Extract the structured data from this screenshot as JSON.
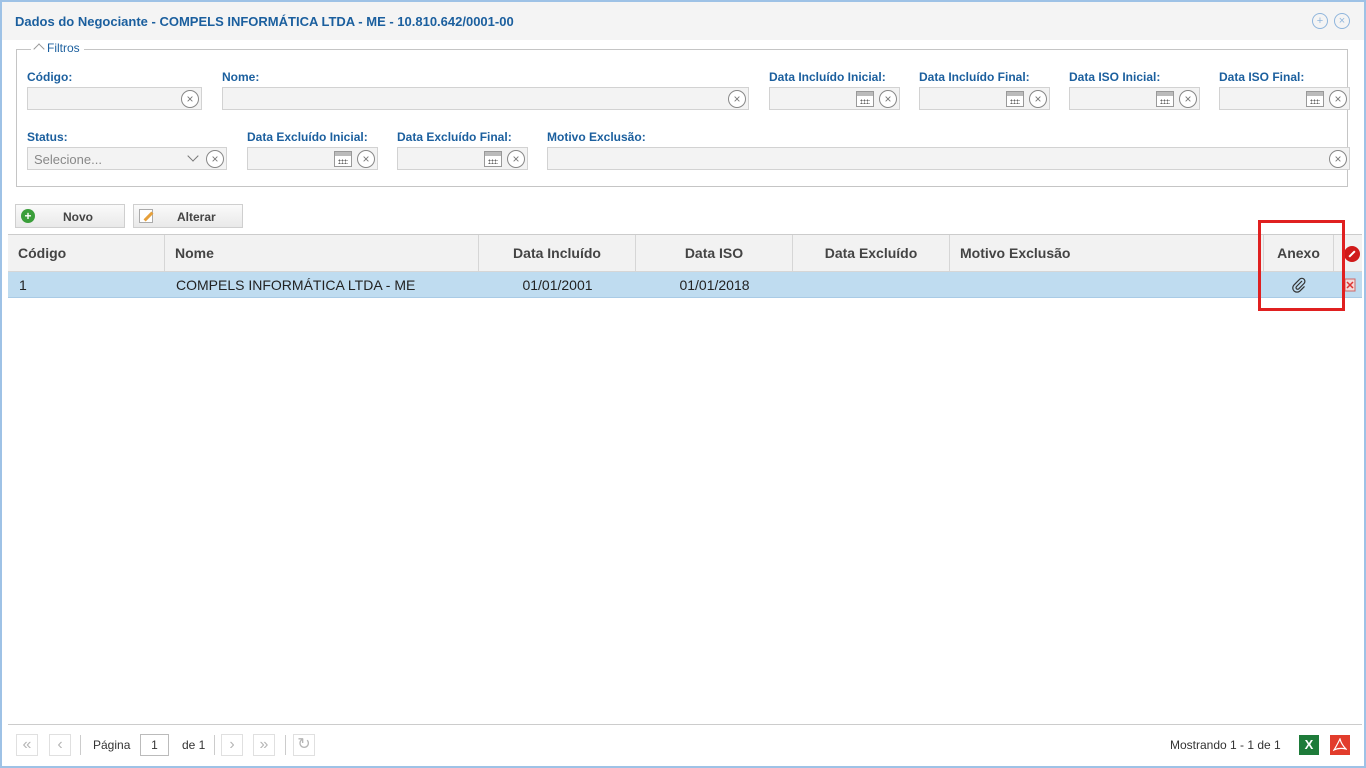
{
  "window": {
    "title": "Dados do Negociante - COMPELS INFORMÁTICA LTDA - ME - 10.810.642/0001-00"
  },
  "filters": {
    "legend": "Filtros",
    "codigo_label": "Código:",
    "nome_label": "Nome:",
    "data_incluido_inicial_label": "Data Incluído Inicial:",
    "data_incluido_final_label": "Data Incluído Final:",
    "data_iso_inicial_label": "Data ISO Inicial:",
    "data_iso_final_label": "Data ISO Final:",
    "status_label": "Status:",
    "status_placeholder": "Selecione...",
    "data_excluido_inicial_label": "Data Excluído Inicial:",
    "data_excluido_final_label": "Data Excluído Final:",
    "motivo_exclusao_label": "Motivo Exclusão:"
  },
  "toolbar": {
    "novo_label": "Novo",
    "alterar_label": "Alterar"
  },
  "grid": {
    "columns": [
      "Código",
      "Nome",
      "Data Incluído",
      "Data ISO",
      "Data Excluído",
      "Motivo Exclusão",
      "Anexo"
    ],
    "rows": [
      {
        "codigo": "1",
        "nome": "COMPELS INFORMÁTICA LTDA - ME",
        "data_incluido": "01/01/2001",
        "data_iso": "01/01/2018",
        "data_excluido": "",
        "motivo_exclusao": ""
      }
    ]
  },
  "pagination": {
    "page_label": "Página",
    "page_value": "1",
    "of_label": "de 1",
    "showing": "Mostrando 1 - 1 de 1"
  },
  "icons": {
    "attachment": "paperclip-icon",
    "delete": "delete-icon",
    "export_excel": "excel-icon",
    "export_pdf": "pdf-icon"
  },
  "colors": {
    "title": "#1b5f9e",
    "selected_row": "#bfdcf0",
    "highlight": "#e02020"
  }
}
